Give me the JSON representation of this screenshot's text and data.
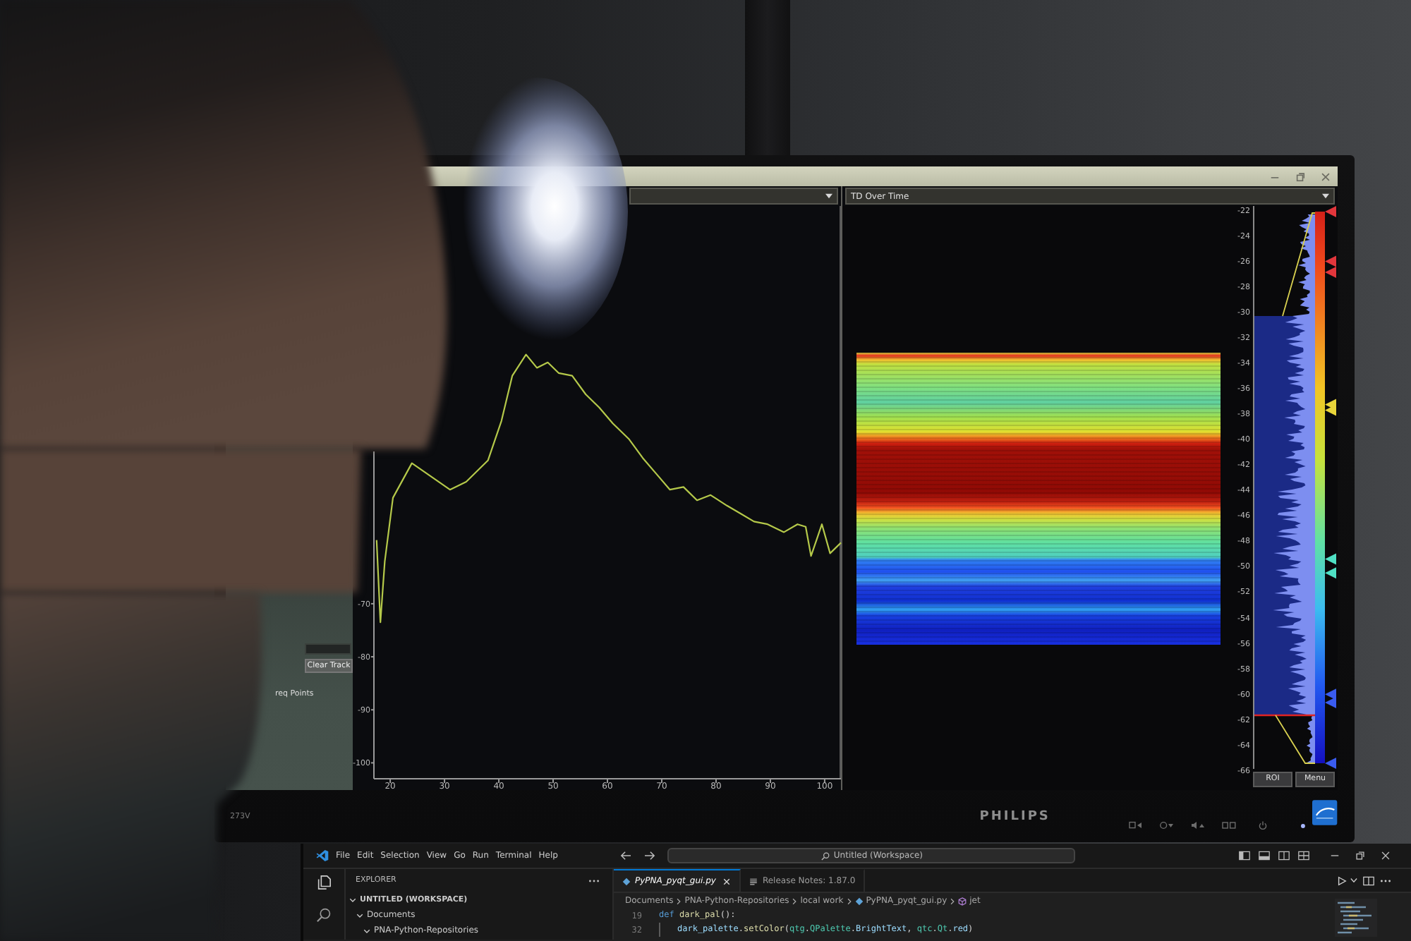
{
  "monitor": {
    "model_label": "273V",
    "brand": "PHILIPS",
    "power_led": {
      "on": true
    }
  },
  "analyzer_window": {
    "left_pane": {
      "side_panel": {
        "buttons": [
          "Clear Track"
        ],
        "label": "req Points"
      },
      "chart_data": {
        "type": "line",
        "x": [
          17.5,
          18.2,
          19,
          20.5,
          24,
          27.5,
          31,
          34,
          38,
          40.5,
          42.5,
          45,
          47,
          49,
          51,
          53.5,
          56,
          58.5,
          61,
          64,
          66.5,
          69,
          71.5,
          74,
          76.5,
          79,
          82,
          84.5,
          87,
          89.5,
          92.5,
          95,
          96.5,
          97.5,
          99.5,
          101,
          103
        ],
        "series": [
          {
            "color": "#b5c94a",
            "values": [
              -58,
              -73.5,
              -62,
              -50,
              -43.5,
              -46,
              -48.5,
              -47,
              -43,
              -35.5,
              -27,
              -23,
              -25.5,
              -24.5,
              -26.5,
              -27,
              -30.5,
              -33,
              -36,
              -39,
              -42.5,
              -45.5,
              -48.5,
              -48,
              -50.5,
              -49.5,
              -51.5,
              -53,
              -54.5,
              -55,
              -56.5,
              -55,
              -55.5,
              -61,
              -55,
              -60.5,
              -58.5
            ]
          }
        ],
        "xlim": [
          17,
          103
        ],
        "ylim": [
          -103,
          5
        ],
        "xticks": [
          20,
          30,
          40,
          50,
          60,
          70,
          80,
          90,
          100
        ],
        "yticks": [
          -70,
          -80,
          -90,
          -100
        ]
      }
    },
    "right_pane": {
      "view_selector": {
        "value": "TD Over Time"
      },
      "level_axis": {
        "ticks": [
          "-22",
          "-24",
          "-26",
          "-28",
          "-30",
          "-32",
          "-34",
          "-36",
          "-38",
          "-40",
          "-42",
          "-44",
          "-46",
          "-48",
          "-50",
          "-52",
          "-54",
          "-56",
          "-58",
          "-60",
          "-62",
          "-64",
          "-66"
        ]
      },
      "gradient_handles": [
        {
          "color": "#e2363c",
          "level": 1
        },
        {
          "color": "#e2363c",
          "level": 0.91
        },
        {
          "color": "#e2363c",
          "level": 0.89
        },
        {
          "color": "#e8d43a",
          "level": 0.65
        },
        {
          "color": "#e8d43a",
          "level": 0.64
        },
        {
          "color": "#4fe0c4",
          "level": 0.37
        },
        {
          "color": "#4fe0c4",
          "level": 0.345
        },
        {
          "color": "#3a5cf0",
          "level": 0.125
        },
        {
          "color": "#3a5cf0",
          "level": 0.11
        },
        {
          "color": "#3a5cf0",
          "level": 0
        }
      ],
      "buttons": [
        "ROI",
        "Menu"
      ]
    }
  },
  "editor_window": {
    "menu": [
      "File",
      "Edit",
      "Selection",
      "View",
      "Go",
      "Run",
      "Terminal",
      "Help"
    ],
    "command_center": "Untitled (Workspace)",
    "explorer": {
      "title": "EXPLORER",
      "tree": [
        {
          "label": "UNTITLED (WORKSPACE)",
          "expanded": true,
          "children": [
            {
              "label": "Documents",
              "expanded": true,
              "children": [
                {
                  "label": "PNA-Python-Repositories",
                  "expanded": true
                }
              ]
            }
          ]
        }
      ]
    },
    "tabs": [
      {
        "label": "PyPNA_pyqt_gui.py",
        "kind": "python",
        "preview": true,
        "selected": true
      },
      {
        "label": "Release Notes: 1.87.0",
        "kind": "notes",
        "preview": false,
        "selected": false
      }
    ],
    "breadcrumbs": [
      {
        "label": "Documents",
        "kind": "folder"
      },
      {
        "label": "PNA-Python-Repositories",
        "kind": "folder"
      },
      {
        "label": "local work",
        "kind": "folder"
      },
      {
        "label": "PyPNA_pyqt_gui.py",
        "kind": "file"
      },
      {
        "label": "jet",
        "kind": "symbol"
      }
    ],
    "code_lines": [
      {
        "number": "19",
        "indented": false,
        "tokens": [
          {
            "text": "def",
            "kind": "keyword"
          },
          {
            "text": " dark_pal",
            "kind": "function"
          },
          {
            "text": "():",
            "kind": "plain"
          }
        ]
      },
      {
        "number": "32",
        "indented": true,
        "tokens": [
          {
            "text": "dark_palette",
            "kind": "variable"
          },
          {
            "text": ".",
            "kind": "plain"
          },
          {
            "text": "setColor",
            "kind": "function"
          },
          {
            "text": "(",
            "kind": "plain"
          },
          {
            "text": "qtg",
            "kind": "module"
          },
          {
            "text": ".",
            "kind": "plain"
          },
          {
            "text": "QPalette",
            "kind": "class"
          },
          {
            "text": ".",
            "kind": "plain"
          },
          {
            "text": "BrightText",
            "kind": "variable"
          },
          {
            "text": ", ",
            "kind": "plain"
          },
          {
            "text": "qtc",
            "kind": "module"
          },
          {
            "text": ".",
            "kind": "plain"
          },
          {
            "text": "Qt",
            "kind": "class"
          },
          {
            "text": ".",
            "kind": "plain"
          },
          {
            "text": "red",
            "kind": "variable"
          },
          {
            "text": ")",
            "kind": "plain"
          }
        ]
      }
    ]
  }
}
